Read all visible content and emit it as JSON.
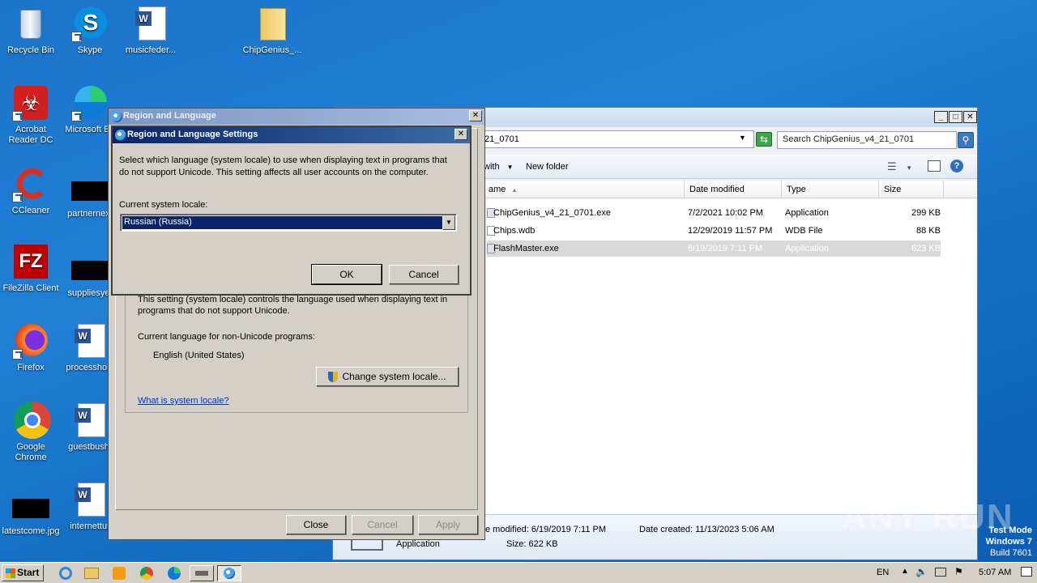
{
  "desktop": {
    "icons": [
      {
        "label": "Recycle Bin"
      },
      {
        "label": "Skype"
      },
      {
        "label": "musicfeder..."
      },
      {
        "label": "ChipGenius_..."
      },
      {
        "label": "Acrobat Reader DC"
      },
      {
        "label": "Microsoft Ed"
      },
      {
        "label": "CCleaner"
      },
      {
        "label": "partnernext"
      },
      {
        "label": "FileZilla Client"
      },
      {
        "label": "suppliesyet"
      },
      {
        "label": "Firefox"
      },
      {
        "label": "processhold"
      },
      {
        "label": "Google Chrome"
      },
      {
        "label": "guestbush."
      },
      {
        "label": "latestcome.jpg"
      },
      {
        "label": "internettur"
      }
    ]
  },
  "explorer": {
    "address": "21_0701",
    "search_placeholder": "Search ChipGenius_v4_21_0701",
    "toolbar": {
      "share_with": "with",
      "new_folder": "New folder"
    },
    "columns": [
      "ame",
      "Date modified",
      "Type",
      "Size"
    ],
    "files": [
      {
        "name": "ChipGenius_v4_21_0701.exe",
        "date": "7/2/2021 10:02 PM",
        "type": "Application",
        "size": "299 KB"
      },
      {
        "name": "Chips.wdb",
        "date": "12/29/2019 11:57 PM",
        "type": "WDB File",
        "size": "88 KB"
      },
      {
        "name": "FlashMaster.exe",
        "date": "6/19/2019 7:11 PM",
        "type": "Application",
        "size": "623 KB"
      }
    ],
    "details": {
      "date_modified": "e modified:  6/19/2019 7:11 PM",
      "date_created": "Date created:  11/13/2023 5:06 AM",
      "kind": "Application",
      "size": "Size:  622 KB"
    }
  },
  "region_dialog": {
    "title": "Region and Language",
    "info_text": "This setting (system locale) controls the language used when displaying text in programs that do not support Unicode.",
    "current_label": "Current language for non-Unicode programs:",
    "current_value": "English (United States)",
    "change_button": "Change system locale...",
    "link": "What is system locale?",
    "buttons": {
      "close": "Close",
      "cancel": "Cancel",
      "apply": "Apply"
    }
  },
  "settings_dialog": {
    "title": "Region and Language Settings",
    "description": "Select which language (system locale) to use when displaying text in programs that do not support Unicode. This setting affects all user accounts on the computer.",
    "locale_label": "Current system locale:",
    "locale_value": "Russian (Russia)",
    "ok": "OK",
    "cancel": "Cancel"
  },
  "taskbar": {
    "start": "Start",
    "lang": "EN",
    "clock": "5:07 AM"
  },
  "watermark": {
    "brand": "ANY RUN",
    "line1": "Test Mode",
    "line2": "Windows 7",
    "line3": "Build 7601"
  },
  "colors": {
    "desktop": "#1b74c9",
    "titlebar_active": "#0a246a",
    "titlebar_inactive": "#7a96c2",
    "selection": "#0a246a"
  }
}
